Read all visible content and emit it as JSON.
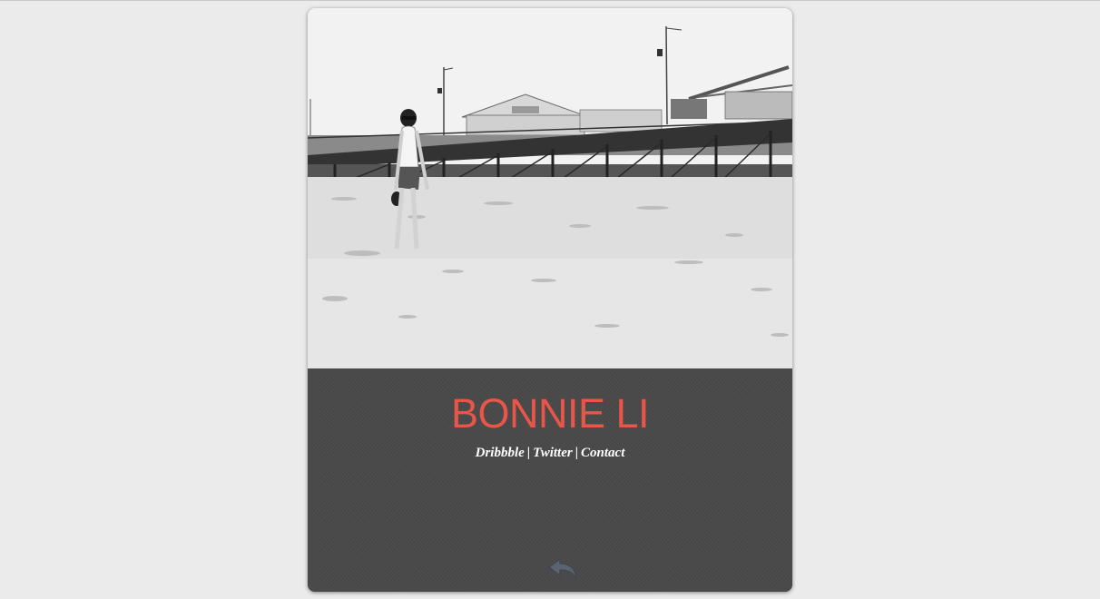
{
  "profile": {
    "name": "BONNIE LI",
    "photo_icon": "beach-pier-photo",
    "name_color": "#e8564a"
  },
  "links": [
    {
      "label": "Dribbble"
    },
    {
      "label": "Twitter"
    },
    {
      "label": "Contact"
    }
  ],
  "separator": "|",
  "back_button": {
    "icon": "back-arrow-icon"
  }
}
